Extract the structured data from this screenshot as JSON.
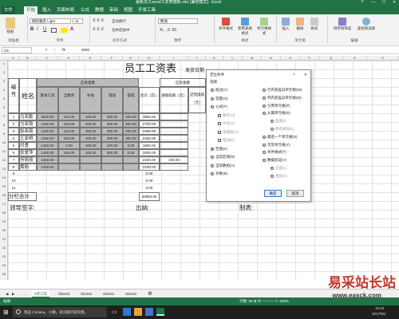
{
  "window": {
    "title": "最新员工excel工资表模板.xlsx [兼容模式] - Excel",
    "controls": [
      "?",
      "—",
      "☐",
      "✕"
    ]
  },
  "ribbon": {
    "tabs": [
      "文件",
      "开始",
      "插入",
      "页面布局",
      "公式",
      "数据",
      "审阅",
      "视图",
      "开发工具"
    ],
    "active_tab": "开始",
    "clipboard": {
      "paste": "粘贴",
      "label": "剪贴板"
    },
    "font": {
      "name": "微软雅黑 Light",
      "size": "11",
      "label": "字体"
    },
    "alignment": {
      "wrap": "自动换行",
      "merge": "合并后居中",
      "label": "对齐方式"
    },
    "number": {
      "format": "数值",
      "label": "数字"
    },
    "styles": {
      "items": [
        "条件格式",
        "套用表格格式",
        "单元格样式"
      ],
      "label": "样式"
    },
    "cells": {
      "items": [
        "插入",
        "删除",
        "格式"
      ],
      "label": "单元格"
    },
    "editing": {
      "items": [
        "排序和筛选",
        "查找和选择"
      ],
      "label": "编辑"
    }
  },
  "formula_bar": {
    "name_box": "C5",
    "fx": "fx",
    "value": "3000"
  },
  "columns": [
    "A",
    "B",
    "C",
    "D",
    "E",
    "F",
    "G",
    "H",
    "I",
    "J",
    "K",
    "L",
    "M",
    "N",
    "O",
    "P",
    "Q",
    "R",
    "S"
  ],
  "rows": [
    "1",
    "2",
    "3",
    "4",
    "5",
    "6",
    "7",
    "8",
    "9",
    "10",
    "11",
    "12",
    "13",
    "14",
    "15",
    "16",
    "17",
    "18",
    "19",
    "20",
    "21",
    "22",
    "23",
    "24",
    "25"
  ],
  "sheet": {
    "title": "员工工资表",
    "issue_date_label": "发放日期",
    "header": {
      "no": "编号",
      "name": "姓名",
      "payable_group": "应发金额",
      "deduct_group": "应扣金额",
      "cols": [
        "基本工资",
        "全勤奖",
        "补助",
        "增加",
        "提成",
        "合计（元）",
        "请假扣款（元）",
        "迟到扣款（元）",
        "其他"
      ]
    },
    "employees": [
      {
        "no": "1",
        "name": "马亚勤",
        "basic": "3000.00",
        "full": "150.00",
        "sub": "100.00",
        "add": "300.00",
        "comm": "300.00",
        "total": "3850.00",
        "leave": ""
      },
      {
        "no": "2",
        "name": "马亚南",
        "basic": "1450.00",
        "full": "150.00",
        "sub": "100.00",
        "add": "200.00",
        "comm": "800.00",
        "total": "2700.00",
        "leave": ""
      },
      {
        "no": "3",
        "name": "张亚南",
        "basic": "1450.00",
        "full": "150.00",
        "sub": "200.00",
        "add": "300.00",
        "comm": "200.00",
        "total": "2300.00",
        "leave": ""
      },
      {
        "no": "4",
        "name": "王亚明",
        "basic": "1450.00",
        "full": "150.00",
        "sub": "100.00",
        "add": "300.00",
        "comm": "300.00",
        "total": "2300.00",
        "leave": ""
      },
      {
        "no": "5",
        "name": "邓勇",
        "basic": "1450.00",
        "full": "0.00",
        "sub": "100.00",
        "add": "100.00",
        "comm": "0.00",
        "total": "1650.00",
        "leave": ""
      },
      {
        "no": "6",
        "name": "张爱萍",
        "basic": "1450.00",
        "full": "150.00",
        "sub": "100.00",
        "add": "300.00",
        "comm": "0.00",
        "total": "2000.00",
        "leave": ""
      },
      {
        "no": "7",
        "name": "何丽丽",
        "basic": "1450.00",
        "full": "",
        "sub": "",
        "add": "",
        "comm": "",
        "total": "2150.00",
        "leave": "330.00"
      },
      {
        "no": "8",
        "name": "黄丽",
        "basic": "1450.00",
        "full": "",
        "sub": "",
        "add": "",
        "comm": "",
        "total": "2100.00",
        "leave": ""
      },
      {
        "no": "9",
        "name": "",
        "basic": "",
        "full": "",
        "sub": "",
        "add": "",
        "comm": "",
        "total": "0.00",
        "leave": ""
      },
      {
        "no": "10",
        "name": "",
        "basic": "",
        "full": "",
        "sub": "",
        "add": "",
        "comm": "",
        "total": "0.00",
        "leave": ""
      },
      {
        "no": "11",
        "name": "",
        "basic": "",
        "full": "",
        "sub": "",
        "add": "",
        "comm": "",
        "total": "0.00",
        "leave": ""
      }
    ],
    "subtotal_label": "分栏合计",
    "subtotal_value": "20850.00",
    "footer": {
      "sign": "领导签字:",
      "cashier": "出纳:",
      "maker": "制表:"
    }
  },
  "dialog": {
    "title": "定位条件",
    "help": "?",
    "close": "✕",
    "section": "选择",
    "left": [
      "批注(C)",
      "常量(O)",
      "公式(F)",
      "数字(U)",
      "文本(X)",
      "逻辑值(G)",
      "错误(E)",
      "空值(K)",
      "当前区域(R)",
      "当前数组(A)",
      "对象(B)"
    ],
    "right": [
      "行内容差异单元格(W)",
      "列内容差异单元格(M)",
      "引用单元格(P)",
      "从属单元格(D)",
      "直属(I)",
      "所有级别(L)",
      "最后一个单元格(S)",
      "可见单元格(Y)",
      "条件格式(T)",
      "数据验证(V)",
      "全部(L)",
      "相同(E)"
    ],
    "selected": "空值(K)",
    "ok": "确定",
    "cancel": "取消"
  },
  "sheet_tabs": [
    "5月工资",
    "Sheet3",
    "Sheet4",
    "Sheet1",
    "Sheet2"
  ],
  "active_sheet": "5月工资",
  "status": {
    "left": "就绪",
    "right": "计数: 56   ⊞ ▣ ─────＋ 100%"
  },
  "taskbar": {
    "search": "我是 Cortana，小娜。有问题尽管问我。",
    "time": "15:03",
    "date": "2017/9/2"
  },
  "watermark": {
    "text": "易采站长站",
    "url": "www.easck.com"
  }
}
